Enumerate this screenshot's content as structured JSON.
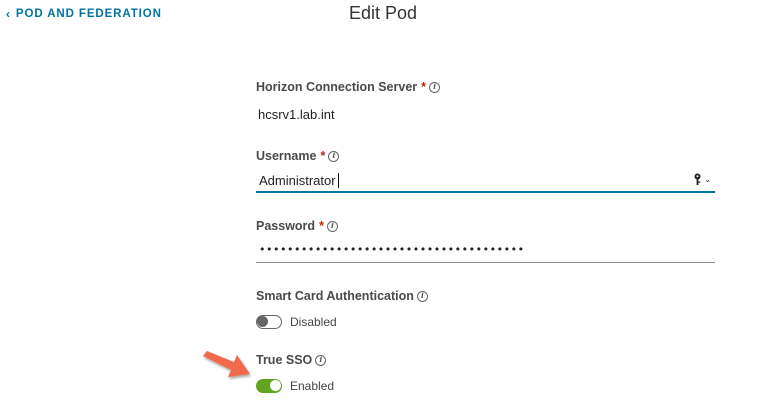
{
  "header": {
    "back_label": "POD AND FEDERATION",
    "title": "Edit Pod"
  },
  "fields": {
    "connection_server": {
      "label": "Horizon Connection Server",
      "required_mark": "*",
      "value": "hcsrv1.lab.int"
    },
    "username": {
      "label": "Username",
      "required_mark": "*",
      "value": "Administrator"
    },
    "password": {
      "label": "Password",
      "required_mark": "*",
      "masked_value": "••••••••••••••••••••••••••••••••••••••"
    },
    "smart_card": {
      "label": "Smart Card Authentication",
      "state": "Disabled"
    },
    "true_sso": {
      "label": "True SSO",
      "state": "Enabled"
    }
  },
  "colors": {
    "link": "#0072a3",
    "required": "#c92100",
    "toggle_on": "#62a420",
    "arrow": "#f26b4b"
  },
  "icons": {
    "back": "chevron-left-icon",
    "info": "info-circle-icon",
    "credential": "key-dropdown-icon",
    "annotation": "red-arrow-icon"
  }
}
